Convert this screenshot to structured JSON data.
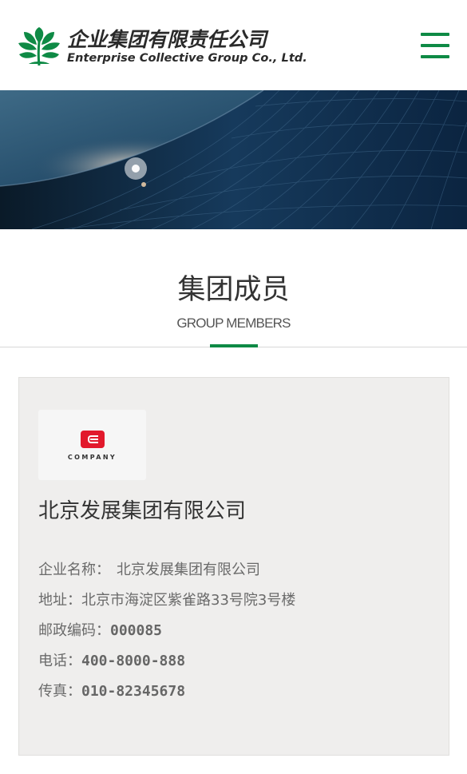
{
  "header": {
    "logo_cn": "企业集团有限责任公司",
    "logo_en": "Enterprise Collective Group Co., Ltd.",
    "menu_icon": "hamburger-menu-icon",
    "logo_icon": "leaf-plant-icon"
  },
  "colors": {
    "brand_green": "#0e8a45",
    "card_bg": "#efeeed",
    "logo_red": "#e2192c",
    "banner_dark": "#0b2a44"
  },
  "section": {
    "title": "集团成员",
    "subtitle": "GROUP MEMBERS"
  },
  "member": {
    "logo_word": "COMPANY",
    "name": "北京发展集团有限公司",
    "info": [
      {
        "label": "企业名称：",
        "value": "北京发展集团有限公司",
        "mono": false
      },
      {
        "label": "地址：",
        "value": "北京市海淀区紫雀路33号院3号楼",
        "mono": false
      },
      {
        "label": "邮政编码：",
        "value": "000085",
        "mono": true
      },
      {
        "label": "电话：",
        "value": "400-8000-888",
        "mono": true
      },
      {
        "label": "传真：",
        "value": "010-82345678",
        "mono": true
      }
    ]
  }
}
